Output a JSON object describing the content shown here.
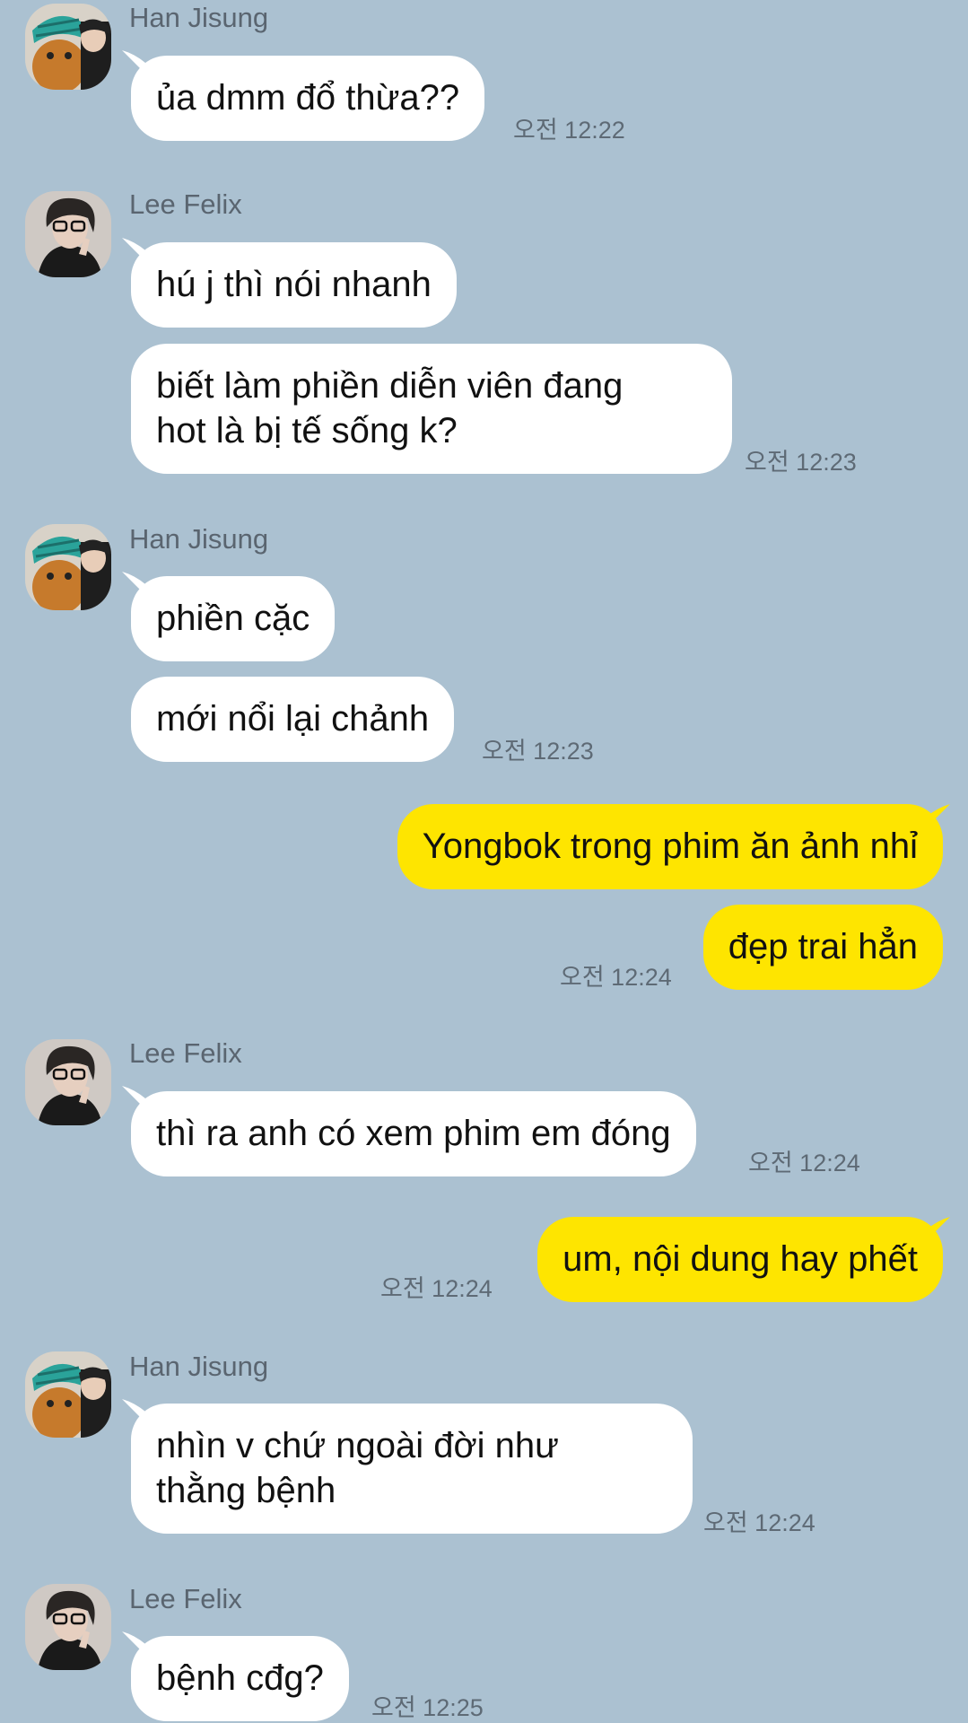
{
  "senders": {
    "han": "Han Jisung",
    "felix": "Lee Felix"
  },
  "colors": {
    "background": "#abc1d1",
    "incoming_bubble": "#ffffff",
    "outgoing_bubble": "#fee500",
    "timestamp": "#5e6a75"
  },
  "messages": [
    {
      "text": "ủa dmm đổ thừa??",
      "time": "오전 12:22"
    },
    {
      "text": "hú j thì nói nhanh"
    },
    {
      "text": "biết làm phiền diễn viên đang\nhot là bị tế sống k?",
      "time": "오전 12:23"
    },
    {
      "text": "phiền cặc"
    },
    {
      "text": "mới nổi lại chảnh",
      "time": "오전 12:23"
    },
    {
      "text": "Yongbok trong phim ăn ảnh nhỉ"
    },
    {
      "text": "đẹp trai hẳn",
      "time": "오전 12:24"
    },
    {
      "text": "thì ra anh có xem phim em đóng",
      "time": "오전 12:24"
    },
    {
      "text": "um, nội dung hay phết",
      "time": "오전 12:24"
    },
    {
      "text": "nhìn v chứ ngoài đời như\nthằng bệnh",
      "time": "오전 12:24"
    },
    {
      "text": "bệnh cđg?",
      "time": "오전 12:25"
    }
  ],
  "icons": {
    "han_avatar": "avatar-han-jisung-icon",
    "felix_avatar": "avatar-lee-felix-icon"
  }
}
